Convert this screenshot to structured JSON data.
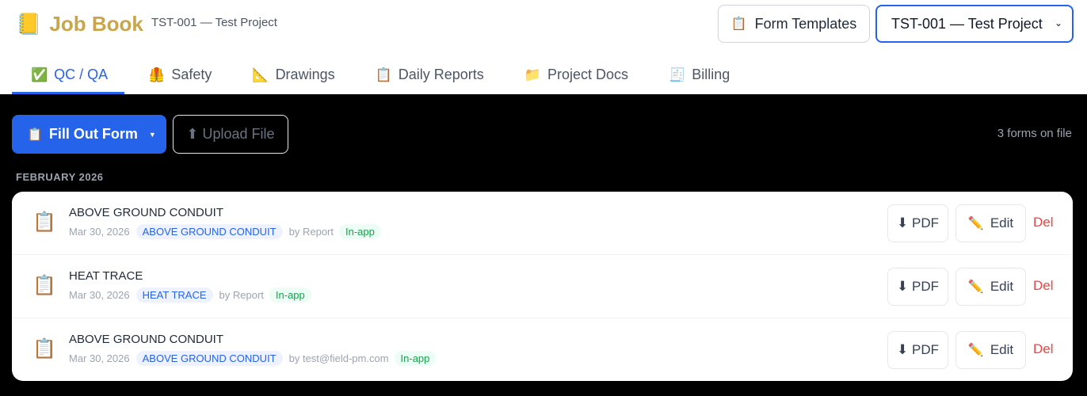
{
  "app": {
    "icon": "notebook-icon",
    "title": "Job Book",
    "subtitle": "TST-001 — Test Project"
  },
  "header": {
    "templates_icon": "clipboard-icon",
    "templates_label": "Form Templates",
    "project_select_value": "TST-001 — Test Project"
  },
  "tabs": [
    {
      "icon": "checkmark-icon",
      "label": "QC / QA",
      "active": true
    },
    {
      "icon": "safety-vest-icon",
      "label": "Safety",
      "active": false
    },
    {
      "icon": "triangle-ruler-icon",
      "label": "Drawings",
      "active": false
    },
    {
      "icon": "clipboard-icon",
      "label": "Daily Reports",
      "active": false
    },
    {
      "icon": "folder-icon",
      "label": "Project Docs",
      "active": false
    },
    {
      "icon": "receipt-icon",
      "label": "Billing",
      "active": false
    }
  ],
  "toolbar": {
    "fill_label": "Fill Out Form",
    "upload_label": "⬆ Upload File",
    "forms_count": "3 forms on file"
  },
  "month_label": "FEBRUARY 2026",
  "forms": [
    {
      "icon": "clipboard-icon",
      "title": "ABOVE GROUND CONDUIT",
      "date": "Mar 30, 2026",
      "type": "ABOVE GROUND CONDUIT",
      "by": "by Report",
      "source": "In-app"
    },
    {
      "icon": "clipboard-icon",
      "title": "HEAT TRACE",
      "date": "Mar 30, 2026",
      "type": "HEAT TRACE",
      "by": "by Report",
      "source": "In-app"
    },
    {
      "icon": "clipboard-icon",
      "title": "ABOVE GROUND CONDUIT",
      "date": "Mar 30, 2026",
      "type": "ABOVE GROUND CONDUIT",
      "by": "by test@field-pm.com",
      "source": "In-app"
    }
  ],
  "row_actions": {
    "pdf_label": "⬇ PDF",
    "edit_label": "Edit",
    "del_label": "Del"
  },
  "colors": {
    "accent": "#2563eb",
    "brand": "#c9a54e",
    "danger": "#ef4444",
    "success": "#16a34a"
  }
}
